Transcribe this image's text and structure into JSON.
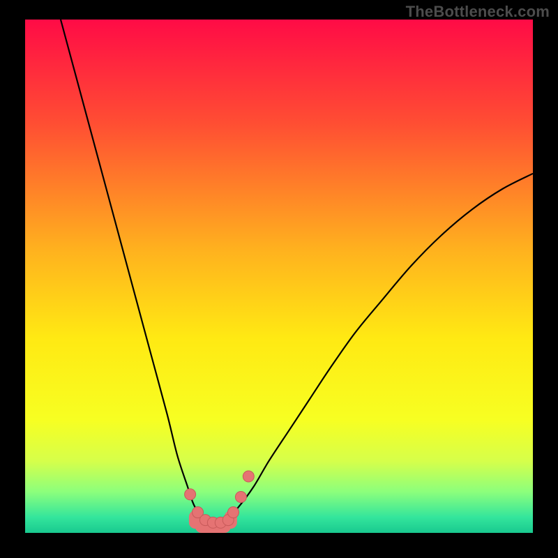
{
  "watermark": "TheBottleneck.com",
  "colors": {
    "background": "#000000",
    "watermark_text": "#4c4c4c",
    "curve_stroke": "#000000",
    "marker_fill": "#e57373",
    "marker_stroke": "#c85a5a",
    "gradient_stops": [
      {
        "offset": 0.0,
        "color": "#ff0b46"
      },
      {
        "offset": 0.2,
        "color": "#ff4d33"
      },
      {
        "offset": 0.45,
        "color": "#ffb21e"
      },
      {
        "offset": 0.62,
        "color": "#ffe913"
      },
      {
        "offset": 0.78,
        "color": "#f7ff22"
      },
      {
        "offset": 0.86,
        "color": "#d6ff4a"
      },
      {
        "offset": 0.92,
        "color": "#8cff7c"
      },
      {
        "offset": 0.97,
        "color": "#33e59c"
      },
      {
        "offset": 1.0,
        "color": "#19c98f"
      }
    ]
  },
  "chart_data": {
    "type": "line",
    "title": "",
    "xlabel": "",
    "ylabel": "",
    "xlim": [
      0,
      100
    ],
    "ylim": [
      0,
      100
    ],
    "grid": false,
    "series": [
      {
        "name": "bottleneck-curve",
        "x": [
          7,
          10,
          13,
          16,
          19,
          22,
          25,
          28,
          30,
          32,
          33,
          34,
          35,
          36,
          37,
          38,
          39,
          40,
          42,
          45,
          48,
          52,
          56,
          60,
          65,
          70,
          76,
          82,
          88,
          94,
          100
        ],
        "y": [
          100,
          89,
          78,
          67,
          56,
          45,
          34,
          23,
          15,
          9,
          6,
          4,
          2.5,
          2,
          2,
          2,
          2.5,
          3,
          5,
          9,
          14,
          20,
          26,
          32,
          39,
          45,
          52,
          58,
          63,
          67,
          70
        ]
      }
    ],
    "markers": {
      "name": "highlight-points",
      "x": [
        32.5,
        34,
        35.5,
        37,
        38.5,
        40,
        41,
        42.5,
        44
      ],
      "y": [
        7.5,
        4,
        2.5,
        2,
        2,
        2.5,
        4,
        7,
        11
      ]
    }
  }
}
